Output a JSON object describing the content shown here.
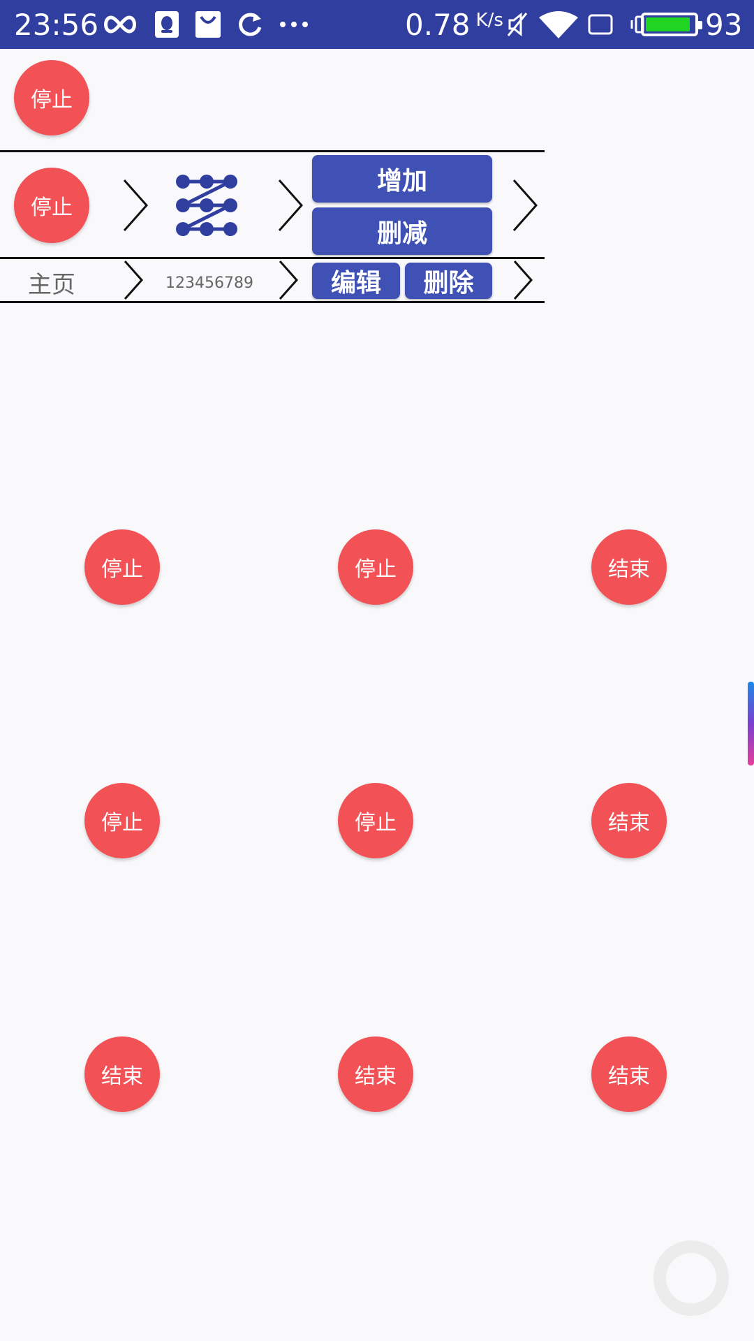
{
  "status_bar": {
    "time": "23:56",
    "speed": "0.78",
    "speed_unit": "K/s",
    "battery_percent": "93",
    "battery_level": 0.93,
    "icons": [
      "infinity-icon",
      "qq-icon",
      "shopping-bag-icon",
      "sync-icon",
      "more-icon",
      "mute-icon",
      "wifi-icon",
      "screen-icon",
      "vibrate-icon",
      "battery-icon"
    ]
  },
  "top_button": {
    "label": "停止"
  },
  "row1": {
    "stop_label": "停止",
    "add_label": "增加",
    "reduce_label": "删减"
  },
  "row2": {
    "home_label": "主页",
    "number_text": "123456789",
    "edit_label": "编辑",
    "delete_label": "删除"
  },
  "grid": {
    "r1": [
      "停止",
      "停止",
      "结束"
    ],
    "r2": [
      "停止",
      "停止",
      "结束"
    ],
    "r3": [
      "结束",
      "结束",
      "结束"
    ]
  },
  "colors": {
    "status_bar": "#303f9f",
    "circle_button": "#f25256",
    "blue_button": "#3f51b5"
  }
}
